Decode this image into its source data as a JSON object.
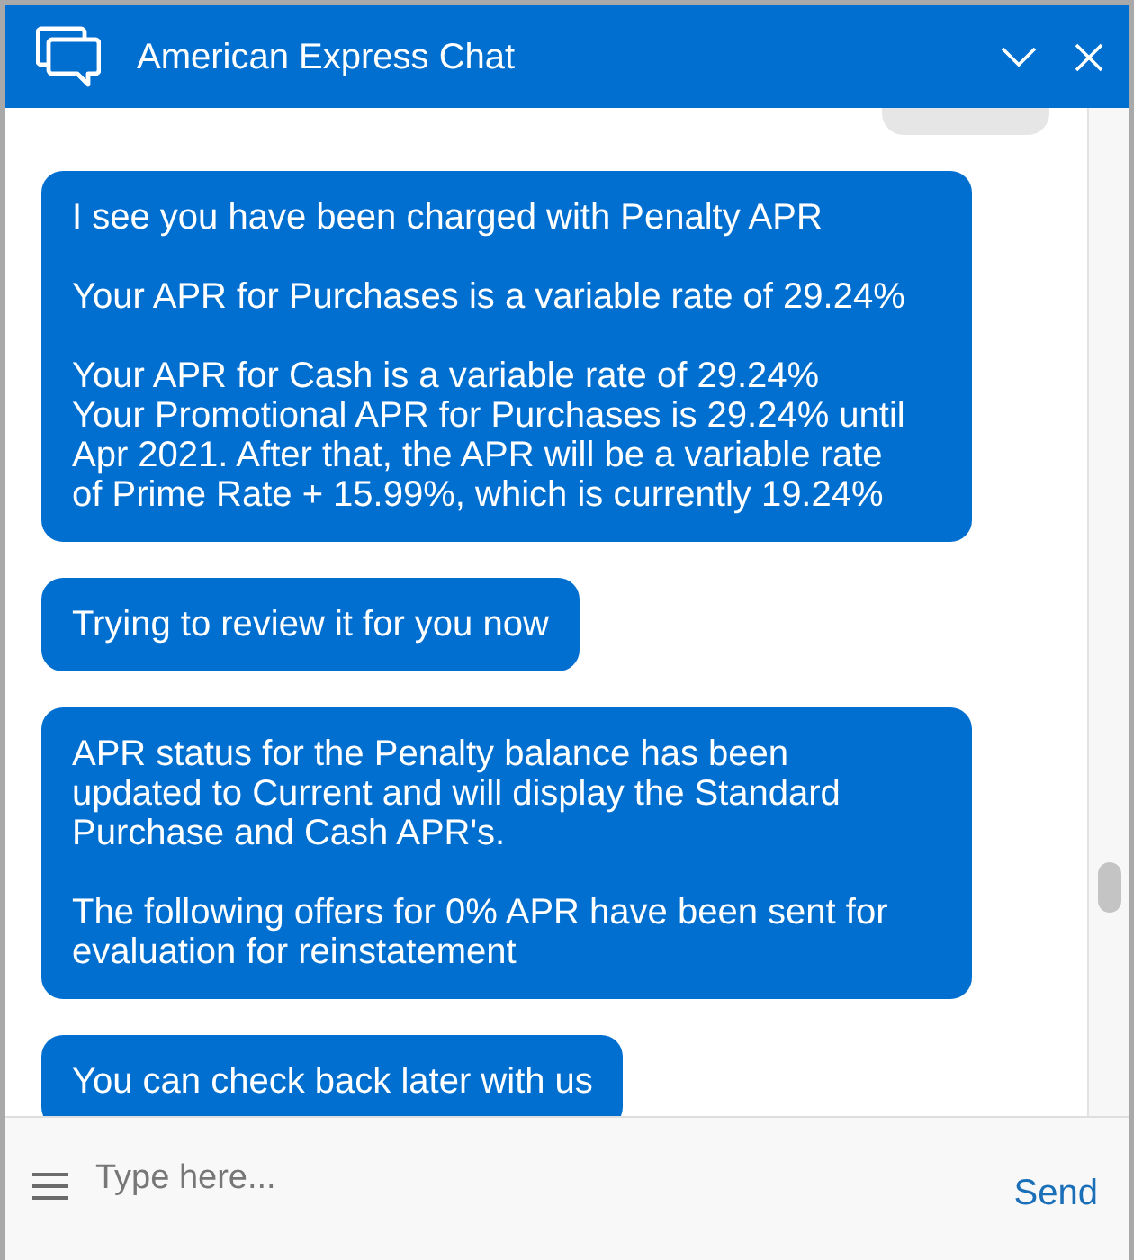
{
  "window": {
    "title": "American Express Chat"
  },
  "messages": [
    {
      "kind": "user"
    },
    {
      "kind": "agent",
      "text": "I see you have been charged with Penalty APR\n\nYour APR for Purchases is a variable rate of 29.24%\n\nYour APR for Cash is a variable rate of 29.24%\nYour Promotional APR for Purchases is 29.24% until\nApr 2021. After that, the APR will be a variable rate\nof Prime Rate + 15.99%, which is currently 19.24%"
    },
    {
      "kind": "agent",
      "text": "Trying to review it for you now"
    },
    {
      "kind": "agent",
      "text": "APR status for the Penalty balance has been\nupdated to Current and will display the Standard\nPurchase and Cash APR's.\n\nThe following offers for 0% APR have been sent for\nevaluation for reinstatement"
    },
    {
      "kind": "agent",
      "text": "You can check back later with us"
    }
  ],
  "composer": {
    "placeholder": "Type here...",
    "send_label": "Send"
  }
}
